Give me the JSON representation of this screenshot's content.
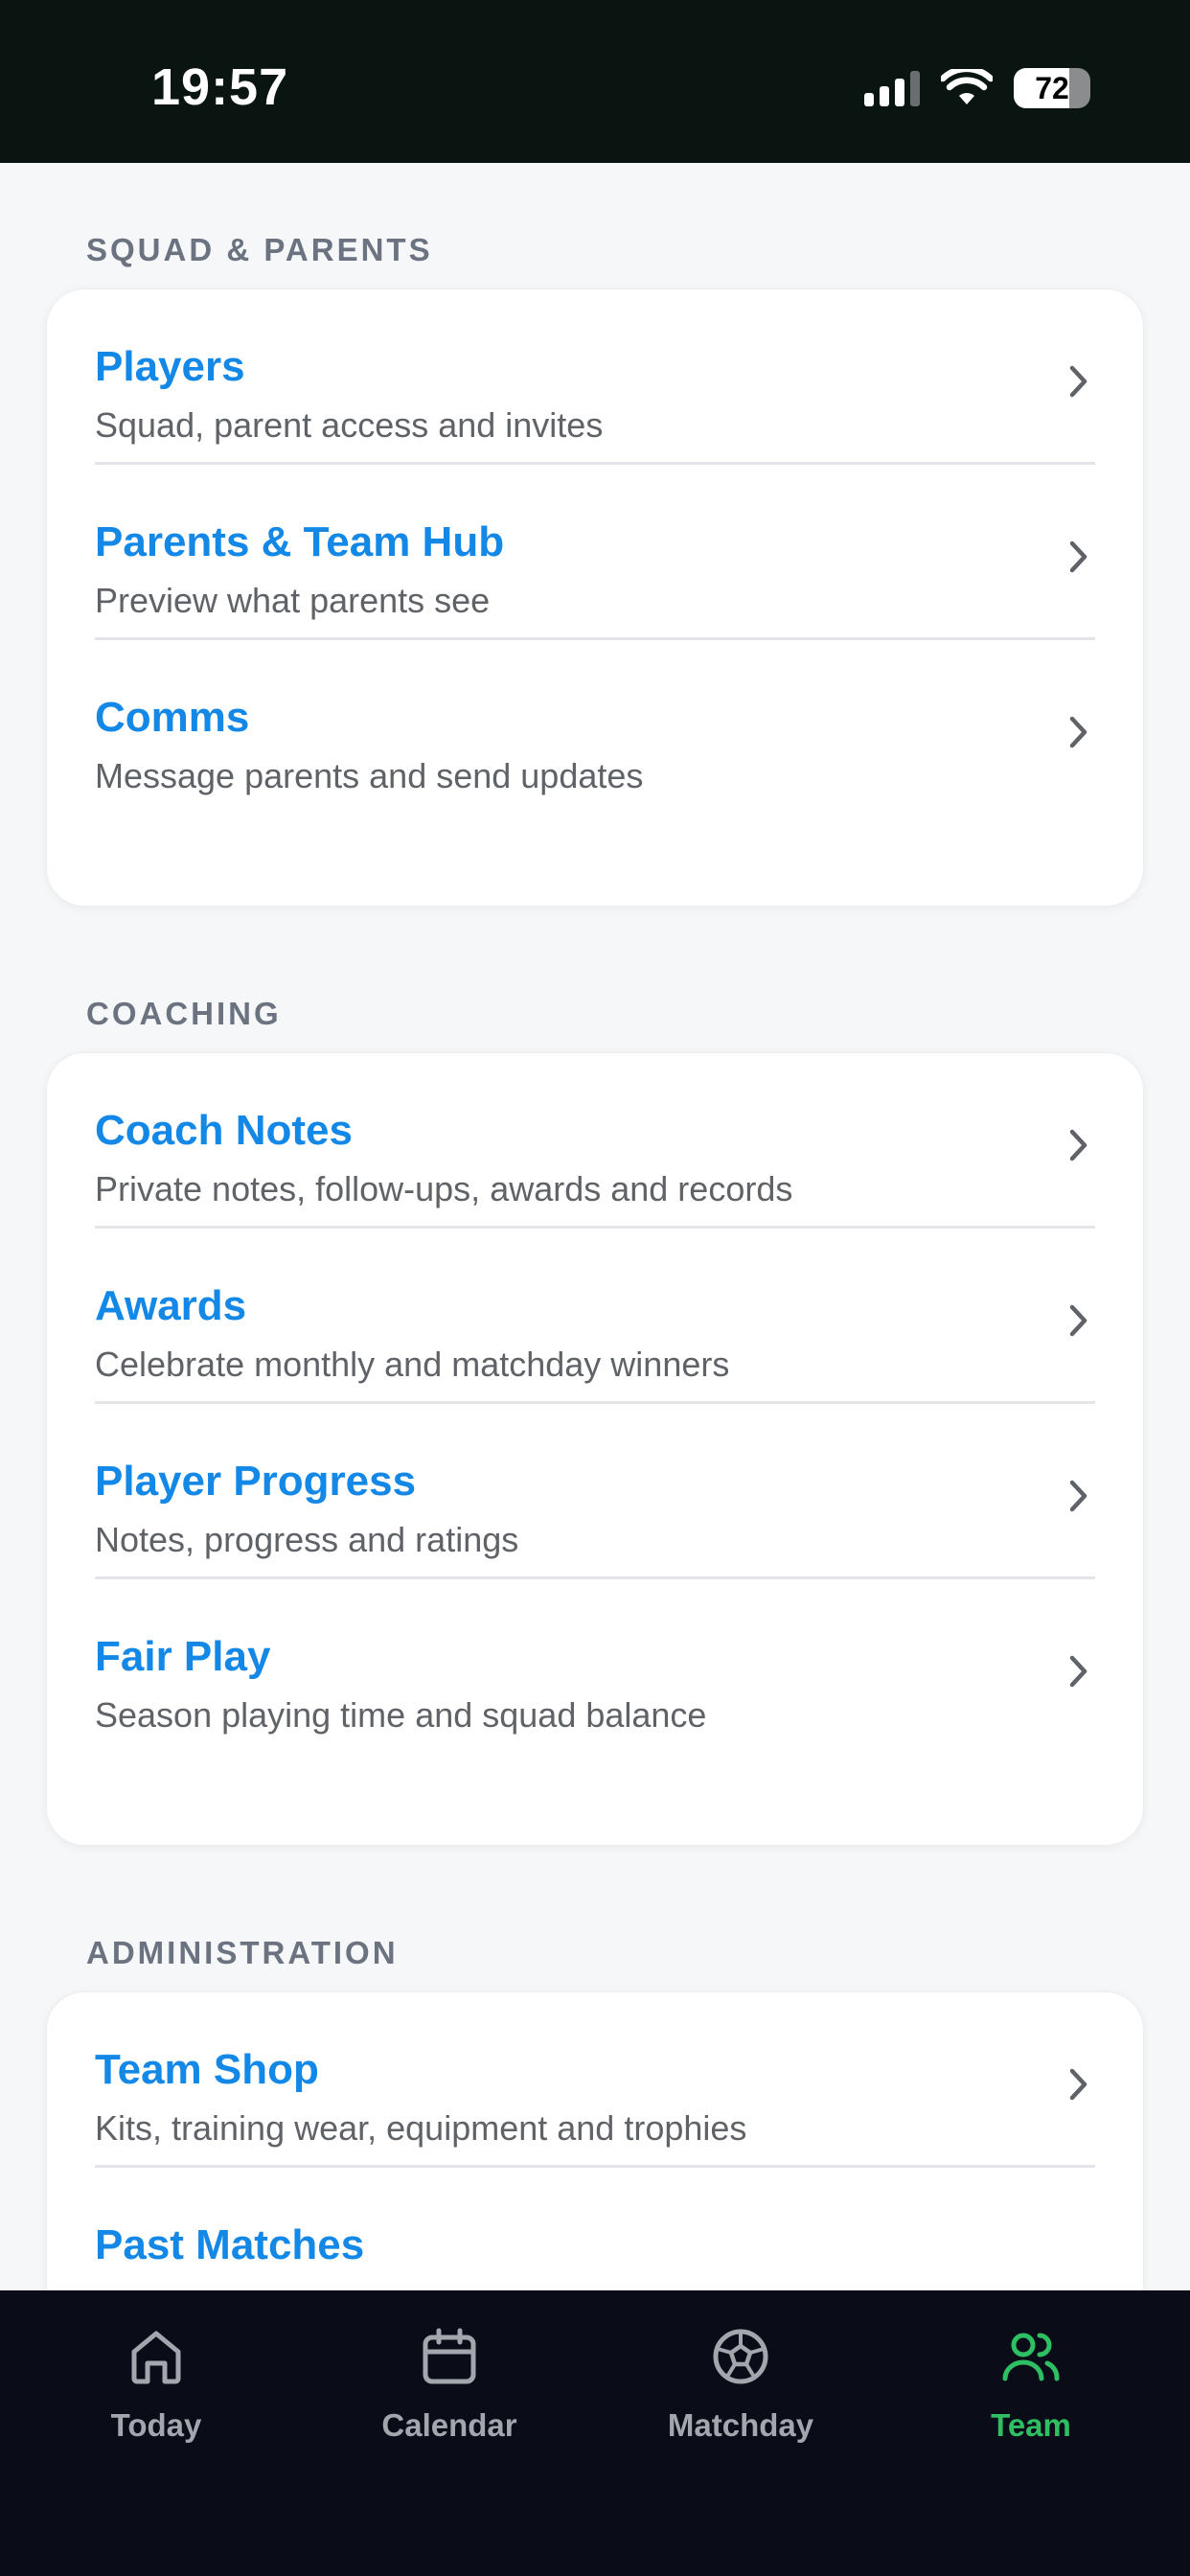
{
  "status_bar": {
    "time": "19:57",
    "battery_text": "72",
    "battery_level": 0.72,
    "signal_bars_active": 3,
    "signal_bars_total": 4
  },
  "sections": [
    {
      "title": "SQUAD & PARENTS",
      "items": [
        {
          "title": "Players",
          "subtitle": "Squad, parent access and invites"
        },
        {
          "title": "Parents & Team Hub",
          "subtitle": "Preview what parents see"
        },
        {
          "title": "Comms",
          "subtitle": "Message parents and send updates"
        }
      ]
    },
    {
      "title": "COACHING",
      "items": [
        {
          "title": "Coach Notes",
          "subtitle": "Private notes, follow-ups, awards and records"
        },
        {
          "title": "Awards",
          "subtitle": "Celebrate monthly and matchday winners"
        },
        {
          "title": "Player Progress",
          "subtitle": "Notes, progress and ratings"
        },
        {
          "title": "Fair Play",
          "subtitle": "Season playing time and squad balance"
        }
      ]
    },
    {
      "title": "ADMINISTRATION",
      "items": [
        {
          "title": "Team Shop",
          "subtitle": "Kits, training wear, equipment and trophies"
        },
        {
          "title": "Past Matches",
          "subtitle": ""
        }
      ]
    }
  ],
  "tab_bar": {
    "tabs": [
      {
        "label": "Today",
        "icon": "home-icon"
      },
      {
        "label": "Calendar",
        "icon": "calendar-icon"
      },
      {
        "label": "Matchday",
        "icon": "soccer-ball-icon"
      },
      {
        "label": "Team",
        "icon": "team-icon"
      }
    ],
    "active": "Team"
  },
  "colors": {
    "accent_link": "#1488e6",
    "active_tab": "#2fbf63",
    "inactive_tab": "#a3a7ad",
    "section_title": "#6b7280",
    "status_bar_bg": "#0a1410",
    "tab_bar_bg": "#0a0d17"
  }
}
